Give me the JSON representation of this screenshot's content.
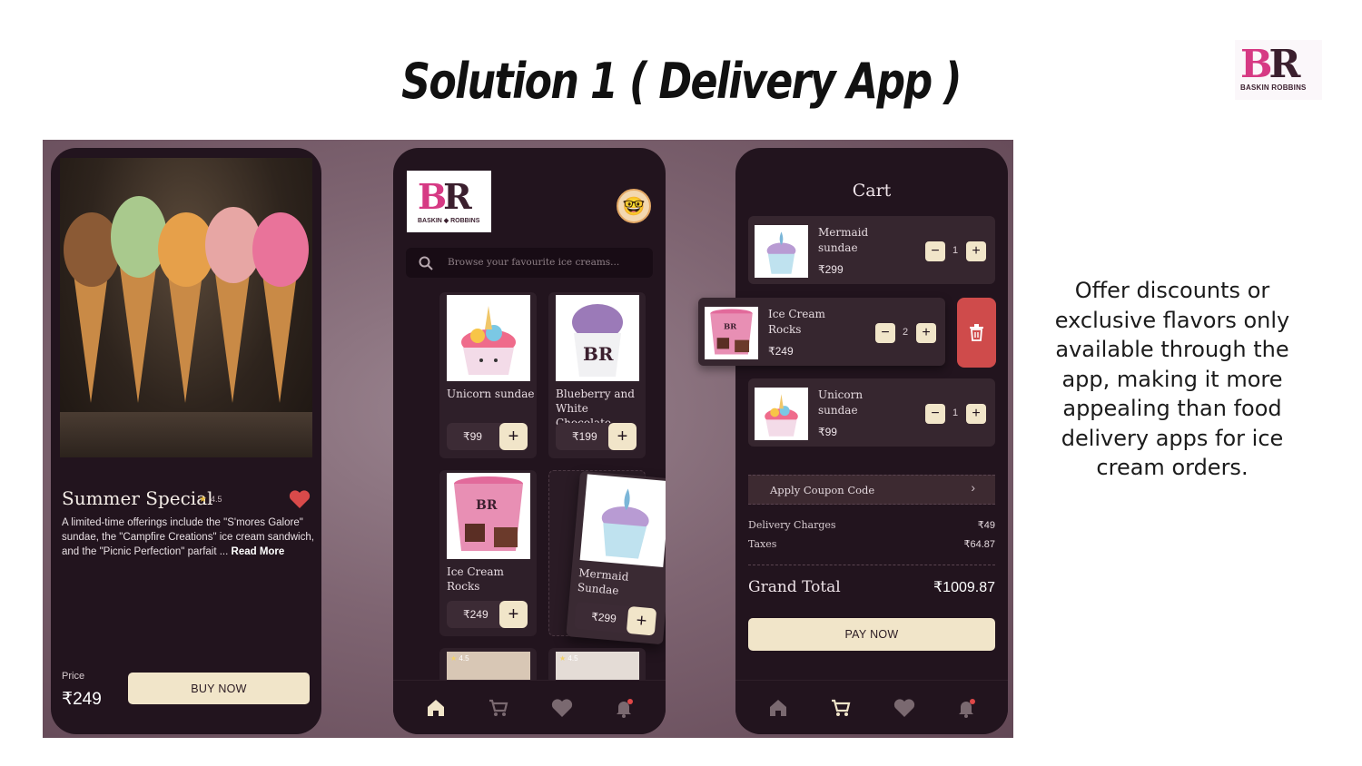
{
  "title": "Solution 1 ( Delivery App )",
  "brand_logo": {
    "letters_b": "B",
    "letters_r": "R",
    "name": "BASKIN ROBBINS"
  },
  "description": "Offer discounts or exclusive flavors only available through the app, making it more appealing than food delivery apps for ice cream orders.",
  "screen_detail": {
    "title": "Summer Special",
    "rating": "4.5",
    "desc": "A limited-time offerings include the \"S'mores Galore\" sundae, the \"Campfire Creations\" ice cream sandwich, and the \"Picnic Perfection\" parfait ... ",
    "read_more": "Read More",
    "price_label": "Price",
    "price": "₹249",
    "buy_label": "BUY NOW"
  },
  "screen_menu": {
    "logo": {
      "letters_b": "B",
      "letters_r": "R",
      "name": "BASKIN ◆ ROBBINS"
    },
    "search_placeholder": "Browse your favourite ice creams...",
    "products": [
      {
        "name": "Unicorn sundae",
        "price": "₹99",
        "icon": "unicorn-sundae"
      },
      {
        "name": "Blueberry and White Chocolate",
        "price": "₹199",
        "icon": "blueberry-cup"
      },
      {
        "name": "Ice Cream Rocks",
        "price": "₹249",
        "icon": "ice-cream-rocks"
      },
      {
        "name": "Mermaid Sundae",
        "price": "₹299",
        "icon": "mermaid-sundae"
      }
    ],
    "partial_ratings": [
      "4.5",
      "4.5"
    ],
    "plus_label": "+"
  },
  "screen_cart": {
    "title": "Cart",
    "items": [
      {
        "name": "Mermaid sundae",
        "price": "₹299",
        "qty": "1"
      },
      {
        "name": "Ice Cream Rocks",
        "price": "₹249",
        "qty": "2"
      },
      {
        "name": "Unicorn sundae",
        "price": "₹99",
        "qty": "1"
      }
    ],
    "coupon_label": "Apply Coupon Code",
    "delivery_label": "Delivery Charges",
    "delivery_value": "₹49",
    "taxes_label": "Taxes",
    "taxes_value": "₹64.87",
    "grand_total_label": "Grand Total",
    "grand_total_value": "₹1009.87",
    "pay_label": "PAY NOW"
  },
  "nav_icons": [
    "home-icon",
    "cart-icon",
    "heart-icon",
    "bell-icon"
  ],
  "colors": {
    "phone_bg": "#22141e",
    "button": "#f1e5c9",
    "accent_pink": "#d63a84",
    "delete_red": "#cf4b4b"
  }
}
